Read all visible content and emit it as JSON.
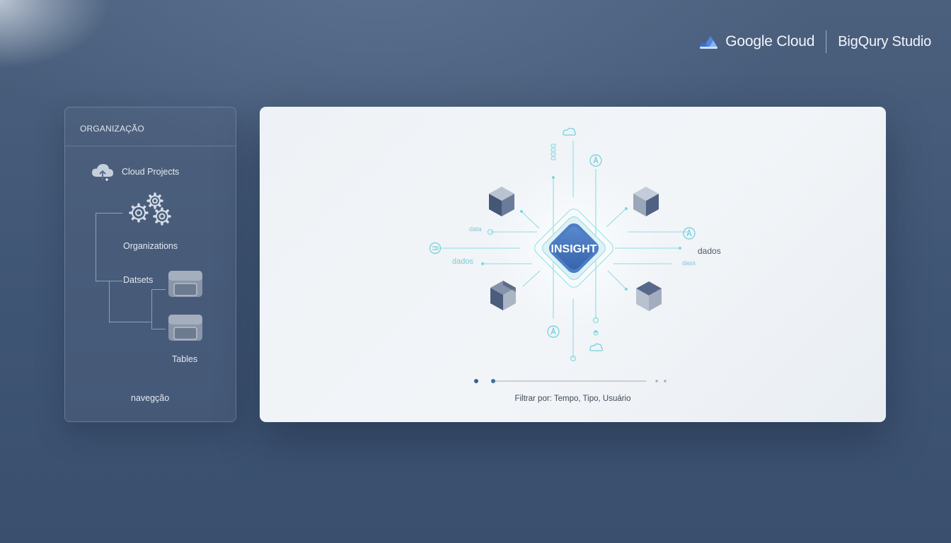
{
  "brand": {
    "name": "Google Cloud",
    "product": "BigQury Studio",
    "logo_icon": "google-cloud-logo-icon"
  },
  "sidebar": {
    "header": "ORGANIZAÇÃO",
    "items": [
      {
        "label": "Cloud Projects",
        "icon": "cloud-upload-icon"
      },
      {
        "label": "Organizations",
        "icon": "gears-icon"
      },
      {
        "label": "Datsets",
        "icon": "dataset-box-icon"
      },
      {
        "label": "Tables",
        "icon": "table-box-icon"
      }
    ],
    "footer": "navegção"
  },
  "main": {
    "center_label": "INSIGHT",
    "node_labels": {
      "left_upper": "data",
      "left_lower": "dados",
      "right_upper": "dados",
      "right_lower": "dass",
      "top_vertical": "oooo"
    },
    "filter": "Filtrar por: Tempo, Tipo, Usuário"
  },
  "colors": {
    "accent_blue": "#3f6fb6",
    "network_cyan": "#7fd9e0",
    "cube_dark": "#4f6283",
    "cube_light": "#a9b5c6"
  }
}
